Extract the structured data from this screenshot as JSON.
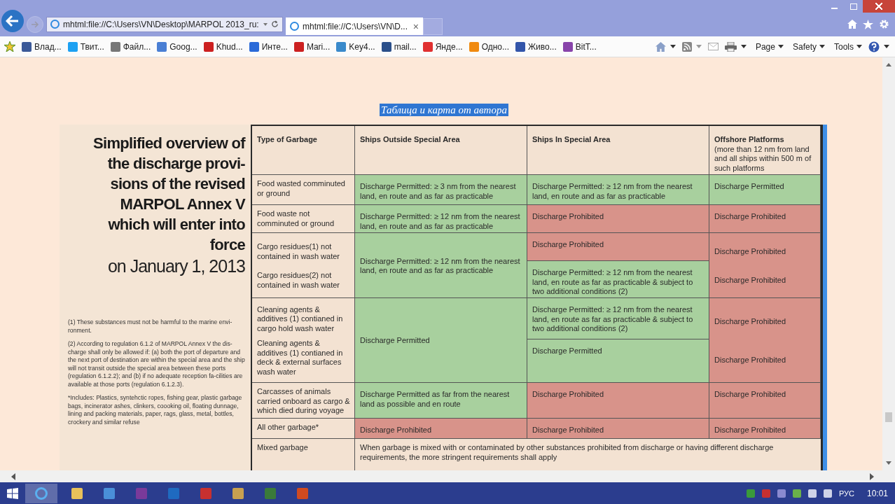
{
  "browser": {
    "address": "mhtml:file://C:\\Users\\VN\\Desktop\\MARPOL 2013_ru:",
    "tab": {
      "title": "mhtml:file://C:\\Users\\VN\\D...",
      "close": "×",
      "selected": true
    },
    "favorites": [
      {
        "label": "Влад...",
        "color": "#3b5998"
      },
      {
        "label": "Твит...",
        "color": "#1da1f2"
      },
      {
        "label": "Файл...",
        "color": "#777777"
      },
      {
        "label": "Goog...",
        "color": "#4a7fd4"
      },
      {
        "label": "Khud...",
        "color": "#cc2020"
      },
      {
        "label": "Инте...",
        "color": "#2a6ad8"
      },
      {
        "label": "Mari...",
        "color": "#cc2020"
      },
      {
        "label": "Key4...",
        "color": "#3a8acb"
      },
      {
        "label": "mail...",
        "color": "#2a4f8a"
      },
      {
        "label": "Янде...",
        "color": "#e03030"
      },
      {
        "label": "Одно...",
        "color": "#f08a10"
      },
      {
        "label": "Живо...",
        "color": "#3355aa"
      },
      {
        "label": "BitT...",
        "color": "#8844aa"
      }
    ],
    "commands": [
      "Page",
      "Safety",
      "Tools"
    ]
  },
  "caption": "Таблица и карта от автора",
  "document": {
    "title_lines": [
      "Simplified overview of",
      "the discharge provi-",
      "sions of the revised",
      "MARPOL Annex V",
      "which will enter into",
      "force"
    ],
    "date": "on January 1, 2013",
    "footnotes": [
      "(1) These substances must not be harmful to the marine envi-ronment.",
      "(2) According to regulation 6.1.2 of MARPOL Annex V the dis-charge shall only be allowed if: (a) both the port of departure and the next port of destination are within the special area and the ship will not transit outside the special area between these ports (regulation 6.1.2.2); and (b) if no adequate reception fa-cilities are available at those ports (regulation 6.1.2.3).",
      "*Includes: Plastics, syntehctic ropes, fishing gear, plastic garbage bags, incinerator ashes, clinkers, coooking oil, floating dunnage, lining and packing materials, paper, rags, glass, metal, bottles, crockery and similar refuse"
    ],
    "table": {
      "rows": [
        {
          "cells": [
            {
              "kind": "header",
              "texts": [
                "Type of Garbage"
              ]
            },
            {
              "kind": "header",
              "texts": [
                "Ships Outside Special Area"
              ]
            },
            {
              "kind": "header",
              "texts": [
                "Ships In Special Area"
              ]
            },
            {
              "kind": "header",
              "texts": [
                "Offshore Platforms"
              ],
              "note": "(more than 12 nm from land and all ships within 500 m of such platforms"
            }
          ]
        },
        {
          "cells": [
            {
              "kind": "type",
              "texts": [
                "Food wasted comminuted or ground"
              ]
            },
            {
              "kind": "permitted",
              "texts": [
                "Discharge Permitted: ≥ 3 nm from the nearest land, en route and as far as practicable"
              ]
            },
            {
              "kind": "permitted",
              "texts": [
                "Discharge Permitted: ≥ 12 nm from the nearest land, en route and as far as practicable"
              ]
            },
            {
              "kind": "permitted",
              "texts": [
                "Discharge Permitted"
              ]
            }
          ]
        },
        {
          "cells": [
            {
              "kind": "type",
              "texts": [
                "Food waste not comminuted or ground"
              ]
            },
            {
              "kind": "permitted",
              "texts": [
                "Discharge Permitted: ≥ 12 nm from the nearest land, en route and as far as practicable"
              ]
            },
            {
              "kind": "prohibited",
              "texts": [
                "Discharge Prohibited"
              ]
            },
            {
              "kind": "prohibited",
              "texts": [
                "Discharge Prohibited"
              ]
            }
          ]
        },
        {
          "cells": [
            {
              "kind": "type",
              "span_next": true,
              "texts": [
                "Cargo residues(1) not contained in wash water",
                "Cargo residues(2) not contained in wash water"
              ]
            },
            {
              "kind": "permitted",
              "span_next": true,
              "texts": [
                "Discharge Permitted: ≥ 12 nm from the nearest land, en route and as far as practicable"
              ]
            },
            {
              "kind": "prohibited",
              "texts": [
                "Discharge Prohibited"
              ]
            },
            {
              "kind": "prohibited",
              "span_next": true,
              "texts": [
                "Discharge Prohibited",
                "Discharge Prohibited"
              ]
            }
          ]
        },
        {
          "cells": [
            {
              "kind": "permitted",
              "texts": [
                "Discharge Permitted: ≥ 12 nm from the nearest land, en route as far as practicable & subject to two additional conditions (2)"
              ]
            }
          ]
        },
        {
          "cells": [
            {
              "kind": "type",
              "span_next": true,
              "texts": [
                "Cleaning agents & additives (1) contianed in cargo hold wash water",
                "Cleaning agents & additives (1) contianed in deck & external surfaces wash water"
              ]
            },
            {
              "kind": "permitted",
              "span_next": true,
              "texts": [
                "Discharge Permitted"
              ]
            },
            {
              "kind": "permitted",
              "texts": [
                "Discharge Permitted: ≥ 12 nm from the nearest land, en route as far as practicable & subject to two additional conditions (2)"
              ]
            },
            {
              "kind": "prohibited",
              "span_next": true,
              "texts": [
                "Discharge Prohibited",
                "Discharge Prohibited"
              ]
            }
          ]
        },
        {
          "cells": [
            {
              "kind": "permitted",
              "texts": [
                "Discharge Permitted"
              ]
            }
          ]
        },
        {
          "cells": [
            {
              "kind": "type",
              "texts": [
                "Carcasses of animals carried onboard as cargo & which died during voyage"
              ]
            },
            {
              "kind": "permitted",
              "texts": [
                "Discharge Permitted as far from the nearest land as possible and en route"
              ]
            },
            {
              "kind": "prohibited",
              "texts": [
                "Discharge Prohibited"
              ]
            },
            {
              "kind": "prohibited",
              "texts": [
                "Discharge Prohibited"
              ]
            }
          ]
        },
        {
          "cells": [
            {
              "kind": "type",
              "texts": [
                "All other garbage*"
              ]
            },
            {
              "kind": "prohibited",
              "texts": [
                "Discharge Prohibited"
              ]
            },
            {
              "kind": "prohibited",
              "texts": [
                "Discharge Prohibited"
              ]
            },
            {
              "kind": "prohibited",
              "texts": [
                "Discharge Prohibited"
              ]
            }
          ]
        },
        {
          "cells": [
            {
              "kind": "type",
              "texts": [
                "Mixed garbage"
              ]
            },
            {
              "kind": "wide",
              "texts": [
                "When garbage is mixed with or contaminated by other substances prohibited from discharge or having different discharge requirements, the more stringent requirements shall apply"
              ]
            }
          ]
        }
      ]
    }
  },
  "taskbar": {
    "language": "РУС",
    "time": "10:01"
  }
}
